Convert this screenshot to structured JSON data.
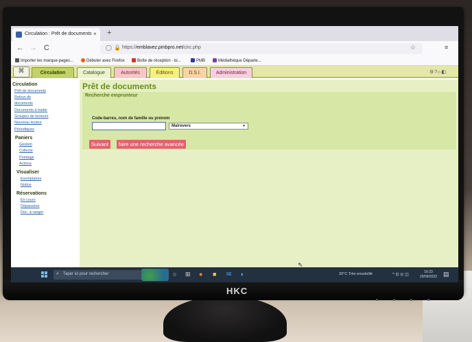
{
  "browser": {
    "tab_title": "Circulation : Prêt de documents",
    "tab_close": "×",
    "new_tab": "+",
    "nav_back": "←",
    "nav_forward": "→",
    "nav_reload": "C",
    "url_prefix": "https://",
    "url_domain": "emblavez.pmbpro.net",
    "url_path": "/circ.php",
    "bookmarks": [
      {
        "label": "Importer les marque-pages...",
        "icon": "import-icon",
        "color": "#555555"
      },
      {
        "label": "Débuter avec Firefox",
        "icon": "firefox-icon",
        "color": "#e66000"
      },
      {
        "label": "Boîte de réception - bi...",
        "icon": "gmail-icon",
        "color": "#d93025"
      },
      {
        "label": "PMB",
        "icon": "pmb-icon",
        "color": "#2b3d8f"
      },
      {
        "label": "Médiathèque Départe...",
        "icon": "mediatheque-icon",
        "color": "#7b3fa0"
      }
    ],
    "menu_icon": "≡"
  },
  "app": {
    "logo_icon": "pmb-logo-icon",
    "tabs": [
      {
        "label": "Circulation",
        "active": true
      },
      {
        "label": "Catalogue"
      },
      {
        "label": "Autorités"
      },
      {
        "label": "Éditions"
      },
      {
        "label": "D.S.I."
      },
      {
        "label": "Administration"
      }
    ],
    "top_icons": "⚙?⌂◧"
  },
  "sidebar": {
    "sections": [
      {
        "title": "Circulation",
        "items": [
          "Prêt de documents",
          "Retour de",
          "documents",
          "Documents à traiter",
          "Groupes de lecteurs",
          "Nouveau lecteur",
          "Périodiques"
        ]
      },
      {
        "title": "Paniers",
        "items": [
          "Gestion",
          "Collecte",
          "Pointage",
          "Actions"
        ]
      },
      {
        "title": "Visualiser",
        "items": [
          "Exemplaires",
          "Notice"
        ]
      },
      {
        "title": "Réservations",
        "items": [
          "En cours",
          "Dépassées",
          "Doc. à ranger"
        ]
      }
    ]
  },
  "main": {
    "title": "Prêt de documents",
    "panel_title": "Recherche emprunteur",
    "field_label": "Code-barres, nom de famille ou prénom",
    "input_value": "",
    "select_value": "Malrevers",
    "buttons": {
      "next": "Suivant",
      "advanced": "faire une recherche avancée"
    }
  },
  "taskbar": {
    "search_placeholder": "Taper ici pour rechercher",
    "weather": "20°C  Très ensoleillé",
    "tray": "^ ⊡ ◎ ◫",
    "time": "16:23",
    "date": "29/09/2022"
  },
  "monitor": {
    "brand": "HKC"
  }
}
